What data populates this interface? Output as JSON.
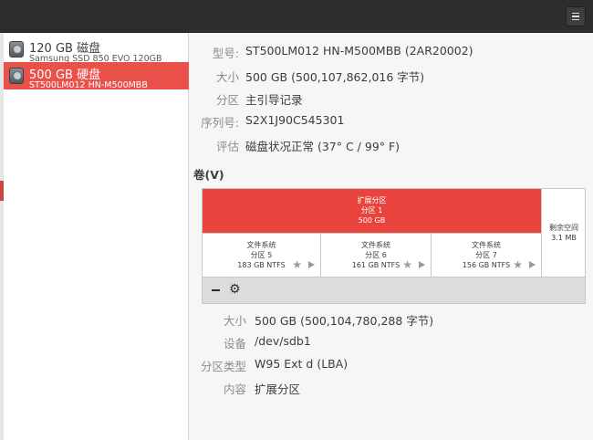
{
  "header": {
    "menu_icon": "hamburger-menu-icon"
  },
  "sidebar": {
    "drives": [
      {
        "name": "120 GB 磁盘",
        "model": "Samsung SSD 850 EVO 120GB",
        "icon": "drive-icon",
        "selected": false
      },
      {
        "name": "500 GB 硬盘",
        "model": "ST500LM012 HN-M500MBB",
        "icon": "drive-icon",
        "selected": true
      }
    ]
  },
  "drive_info": {
    "model_label": "型号",
    "model_value": "ST500LM012 HN-M500MBB (2AR20002)",
    "size_label": "大小",
    "size_value": "500 GB (500,107,862,016 字节)",
    "partitioning_label": "分区",
    "partitioning_value": "主引导记录",
    "serial_label": "序列号",
    "serial_value": "S2X1J90C545301",
    "assessment_label": "评估",
    "assessment_value": "磁盘状况正常 (37° C / 99° F)"
  },
  "volumes": {
    "title": "卷(V)",
    "extended": {
      "line1": "扩展分区",
      "line2": "分区 1",
      "line3": "500 GB"
    },
    "logical": [
      {
        "line1": "文件系统",
        "line2": "分区 5",
        "line3": "183 GB NTFS"
      },
      {
        "line1": "文件系统",
        "line2": "分区 6",
        "line3": "161 GB NTFS"
      },
      {
        "line1": "文件系统",
        "line2": "分区 7",
        "line3": "156 GB NTFS"
      }
    ],
    "free": {
      "line1": "剩余空间",
      "line2": "3.1 MB"
    },
    "toolbar": {
      "remove_icon": "minus-icon",
      "settings_icon": "gears-icon"
    }
  },
  "partition_info": {
    "size_label": "大小",
    "size_value": "500 GB (500,104,780,288 字节)",
    "device_label": "设备",
    "device_value": "/dev/sdb1",
    "type_label": "分区类型",
    "type_value": "W95 Ext d (LBA)",
    "contents_label": "内容",
    "contents_value": "扩展分区"
  },
  "colors": {
    "accent": "#e9514a",
    "extended_partition": "#e9453e",
    "headerbar": "#2d2d2d"
  }
}
